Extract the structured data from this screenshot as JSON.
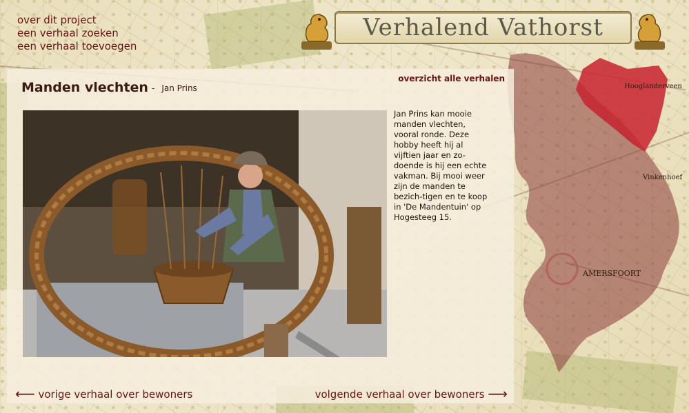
{
  "nav": {
    "items": [
      "over dit project",
      "een verhaal zoeken",
      "een verhaal toevoegen"
    ]
  },
  "banner": {
    "title": "Verhalend Vathorst"
  },
  "map": {
    "labels": [
      "Hooglanderveen",
      "Vinkenhoef",
      "AMERSFOORT"
    ]
  },
  "story": {
    "title": "Manden vlechten",
    "separator": "-",
    "author": "Jan Prins",
    "text": "Jan Prins kan mooie manden vlechten, vooral ronde. Deze hobby heeft hij al vijftien jaar en zo-doende is hij een echte vakman. Bij mooi weer zijn de manden te bezich-tigen en te koop in 'De Mandentuin' op Hogesteeg 15."
  },
  "links": {
    "overview": "overzicht alle verhalen",
    "prev": "vorige verhaal over bewoners",
    "next": "volgende verhaal over bewoners",
    "prev_arrow": "⟵",
    "next_arrow": "⟶"
  },
  "colors": {
    "accent": "#6a1410",
    "region": "#8b3a3a",
    "highlight": "#c8222e"
  }
}
